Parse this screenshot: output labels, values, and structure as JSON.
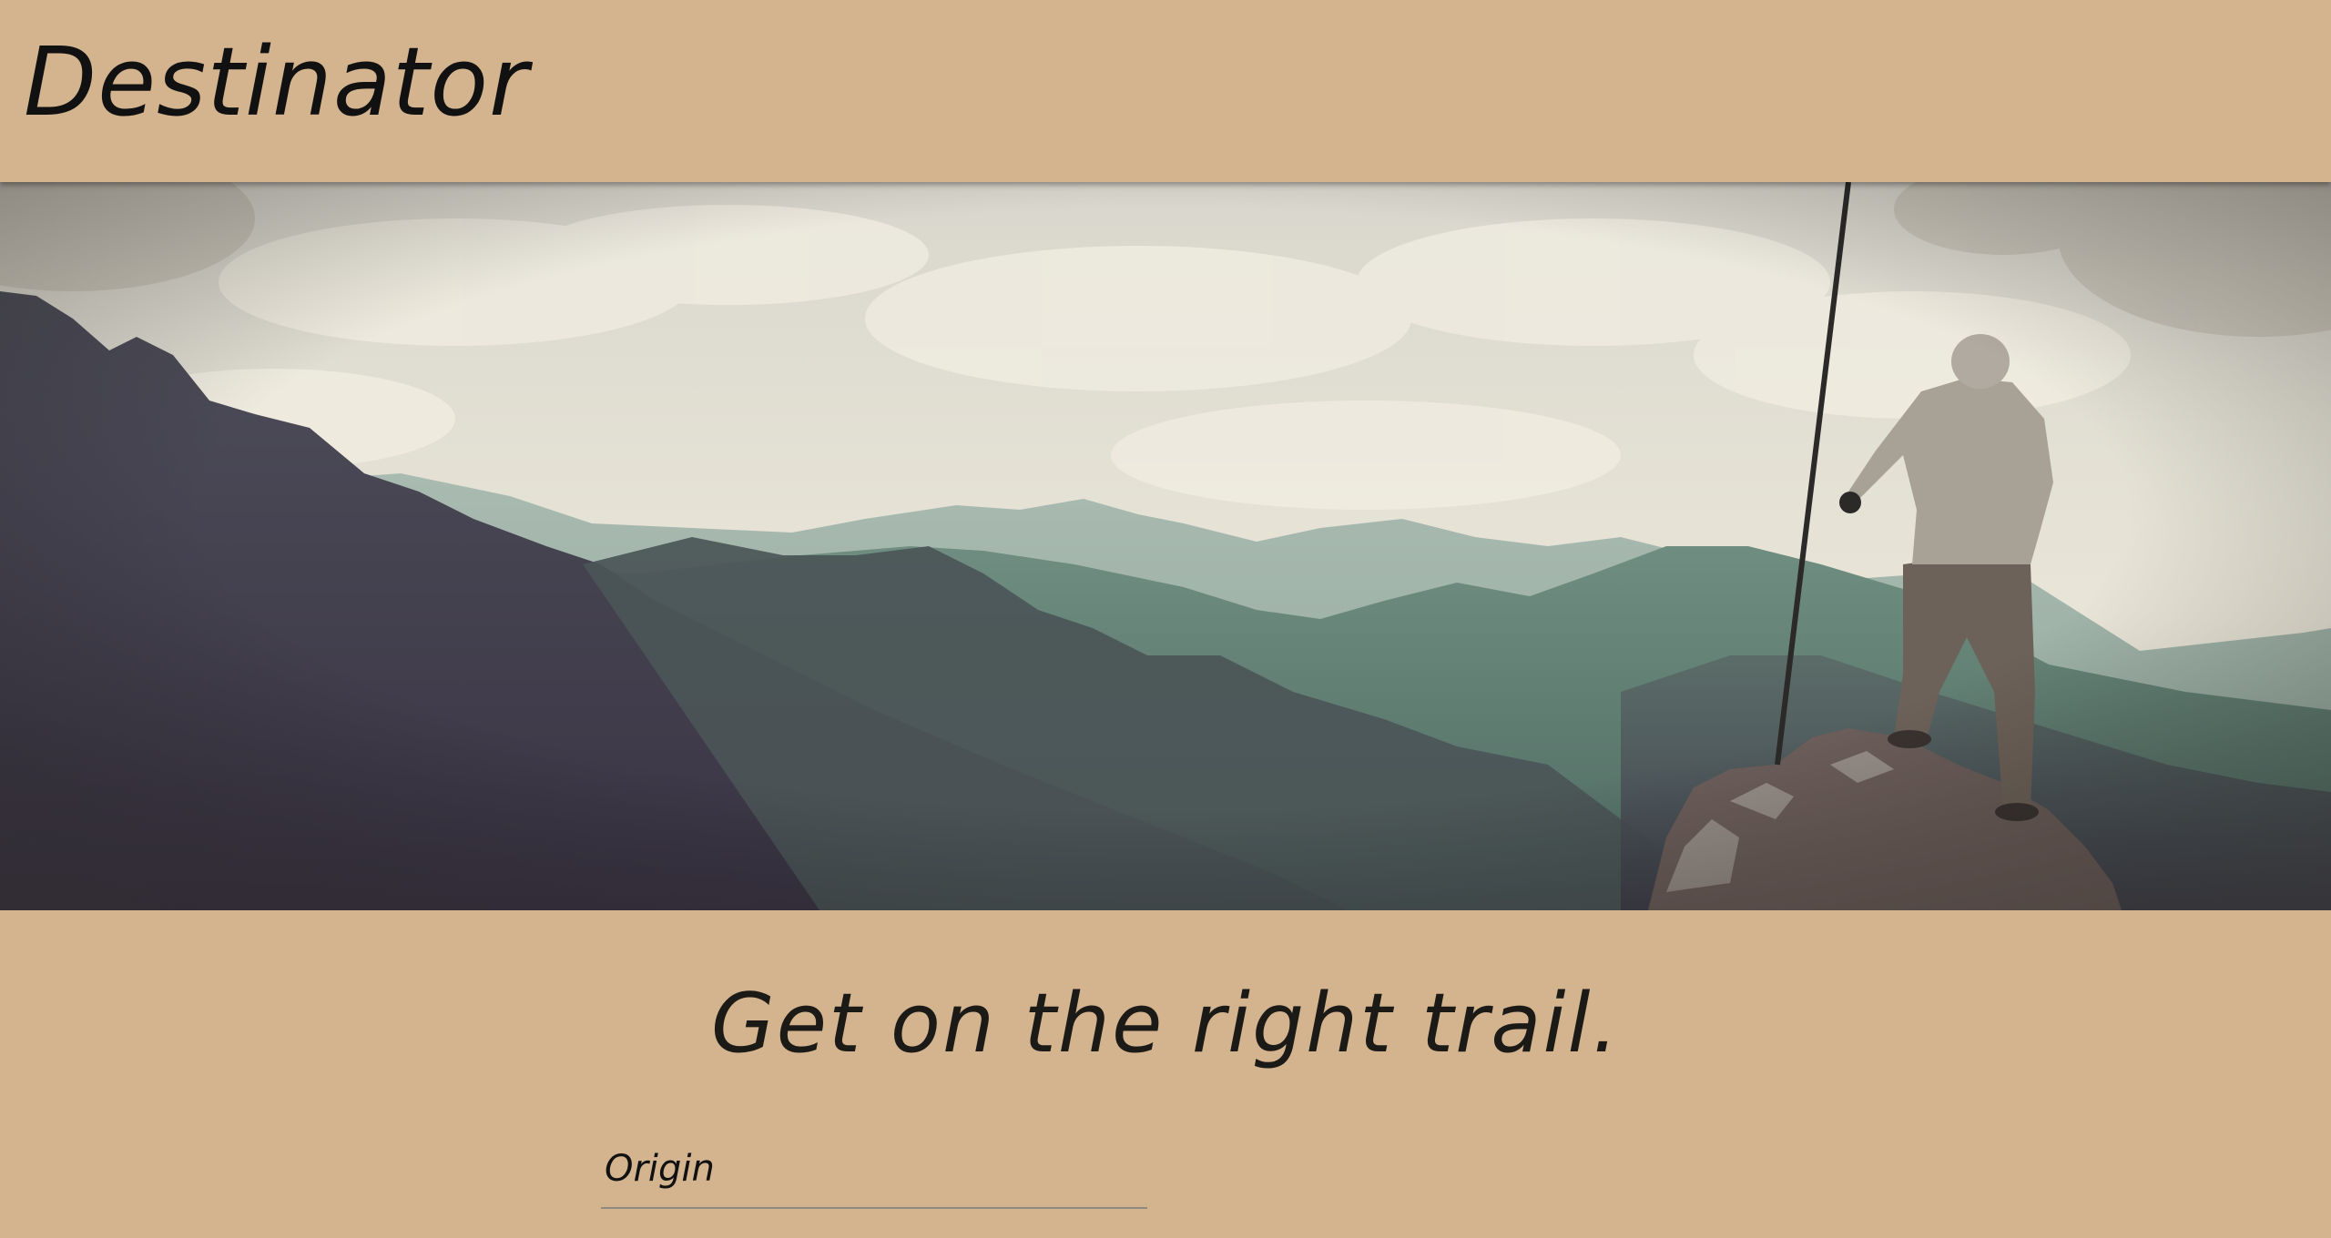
{
  "app": {
    "title": "Destinator"
  },
  "hero": {
    "image_description_name": "mountain-hiker-photo"
  },
  "main": {
    "tagline": "Get on the right trail."
  },
  "form": {
    "origin_label": "Origin",
    "origin_value": ""
  },
  "colors": {
    "background": "#d3b48f",
    "text": "#111111"
  }
}
